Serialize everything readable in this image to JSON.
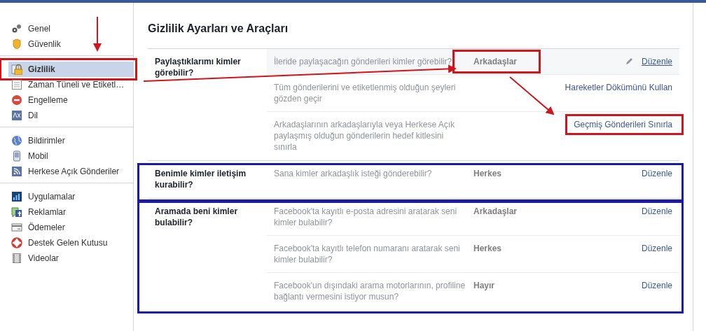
{
  "title": "Gizlilik Ayarları ve Araçları",
  "sidebar": {
    "groups": [
      {
        "items": [
          {
            "label": "Genel",
            "selected": false,
            "annotated": false
          },
          {
            "label": "Güvenlik",
            "selected": false,
            "annotated": false
          }
        ]
      },
      {
        "items": [
          {
            "label": "Gizlilik",
            "selected": true,
            "annotated": true
          },
          {
            "label": "Zaman Tüneli ve Etiketl…",
            "selected": false,
            "annotated": false
          },
          {
            "label": "Engelleme",
            "selected": false,
            "annotated": false
          },
          {
            "label": "Dil",
            "selected": false,
            "annotated": false
          }
        ]
      },
      {
        "items": [
          {
            "label": "Bildirimler",
            "selected": false,
            "annotated": false
          },
          {
            "label": "Mobil",
            "selected": false,
            "annotated": false
          },
          {
            "label": "Herkese Açık Gönderiler",
            "selected": false,
            "annotated": false
          }
        ]
      },
      {
        "items": [
          {
            "label": "Uygulamalar",
            "selected": false,
            "annotated": false
          },
          {
            "label": "Reklamlar",
            "selected": false,
            "annotated": false
          },
          {
            "label": "Ödemeler",
            "selected": false,
            "annotated": false
          },
          {
            "label": "Destek Gelen Kutusu",
            "selected": false,
            "annotated": false
          },
          {
            "label": "Videolar",
            "selected": false,
            "annotated": false
          }
        ]
      }
    ]
  },
  "sections": [
    {
      "label": "Paylaştıklarımı kimler görebilir?",
      "annotated": false,
      "rows": [
        {
          "description": "İleride paylaşacağın gönderileri kimler görebilir?",
          "value": "Arkadaşlar",
          "value_annotated": true,
          "action": "Düzenle",
          "action_annotated": false,
          "hovered": true
        },
        {
          "description": "Tüm gönderilerini ve etiketlenmiş olduğun şeyleri gözden geçir",
          "action": "Hareketler Dökümünü Kullan",
          "action_annotated": false,
          "hovered": false
        },
        {
          "description": "Arkadaşlarının arkadaşlarıyla veya Herkese Açık paylaşmış olduğun gönderilerin hedef kitlesini sınırla",
          "action": "Geçmiş Gönderileri Sınırla",
          "action_annotated": true,
          "hovered": false
        }
      ]
    },
    {
      "label": "Benimle kimler iletişim kurabilir?",
      "annotated": true,
      "rows": [
        {
          "description": "Sana kimler arkadaşlık isteği gönderebilir?",
          "value": "Herkes",
          "value_annotated": false,
          "action": "Düzenle",
          "action_annotated": false,
          "hovered": false
        }
      ]
    },
    {
      "label": "Aramada beni kimler bulabilir?",
      "annotated": true,
      "rows": [
        {
          "description": "Facebook'ta kayıtlı e-posta adresini aratarak seni kimler bulabilir?",
          "value": "Arkadaşlar",
          "value_annotated": false,
          "action": "Düzenle",
          "action_annotated": false,
          "hovered": false
        },
        {
          "description": "Facebook'ta kayıtlı telefon numaranı aratarak seni kimler bulabilir?",
          "value": "Herkes",
          "value_annotated": false,
          "action": "Düzenle",
          "action_annotated": false,
          "hovered": false
        },
        {
          "description": "Facebook'un dışındaki arama motorlarının, profiline bağlantı vermesini istiyor musun?",
          "value": "Hayır",
          "value_annotated": false,
          "action": "Düzenle",
          "action_annotated": false,
          "hovered": false
        }
      ]
    }
  ]
}
